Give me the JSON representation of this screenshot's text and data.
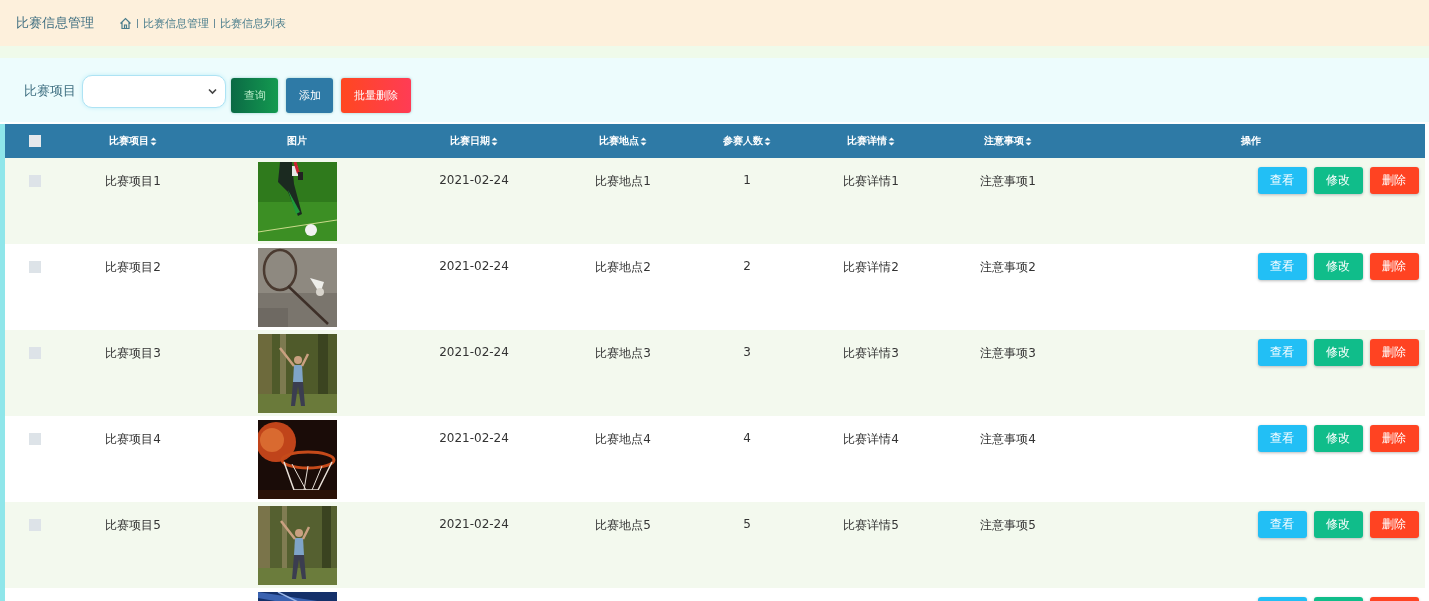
{
  "header": {
    "title": "比赛信息管理",
    "breadcrumb": [
      "比赛信息管理",
      "比赛信息列表"
    ]
  },
  "toolbar": {
    "filter_label": "比赛项目",
    "buttons": [
      {
        "label": "查询",
        "kind": "search"
      },
      {
        "label": "添加",
        "kind": "add"
      },
      {
        "label": "批量删除",
        "kind": "bulkdelete"
      }
    ]
  },
  "table": {
    "select_all": {
      "checked": false
    },
    "columns": [
      {
        "label": "比赛项目",
        "sortable": true
      },
      {
        "label": "图片",
        "sortable": false
      },
      {
        "label": "比赛日期",
        "sortable": true
      },
      {
        "label": "比赛地点",
        "sortable": true
      },
      {
        "label": "参赛人数",
        "sortable": true
      },
      {
        "label": "比赛详情",
        "sortable": true
      },
      {
        "label": "注意事项",
        "sortable": true
      },
      {
        "label": "操作",
        "sortable": false
      }
    ],
    "rows": [
      {
        "kind": "full",
        "checked": false,
        "cells": [
          "比赛项目1",
          "",
          "2021-02-24",
          "比赛地点1",
          "1",
          "比赛详情1",
          "注意事项1"
        ],
        "image": {
          "kind": "picture"
        },
        "actions": [
          {
            "label": "查看",
            "kind": "view"
          },
          {
            "label": "修改",
            "kind": "edit"
          },
          {
            "label": "删除",
            "kind": "delete"
          }
        ]
      },
      {
        "kind": "full",
        "checked": false,
        "cells": [
          "比赛项目2",
          "",
          "2021-02-24",
          "比赛地点2",
          "2",
          "比赛详情2",
          "注意事项2"
        ],
        "image": {
          "kind": "picture"
        },
        "actions": [
          {
            "label": "查看",
            "kind": "view"
          },
          {
            "label": "修改",
            "kind": "edit"
          },
          {
            "label": "删除",
            "kind": "delete"
          }
        ]
      },
      {
        "kind": "full",
        "checked": false,
        "cells": [
          "比赛项目3",
          "",
          "2021-02-24",
          "比赛地点3",
          "3",
          "比赛详情3",
          "注意事项3"
        ],
        "image": {
          "kind": "picture"
        },
        "actions": [
          {
            "label": "查看",
            "kind": "view"
          },
          {
            "label": "修改",
            "kind": "edit"
          },
          {
            "label": "删除",
            "kind": "delete"
          }
        ]
      },
      {
        "kind": "full",
        "checked": false,
        "cells": [
          "比赛项目4",
          "",
          "2021-02-24",
          "比赛地点4",
          "4",
          "比赛详情4",
          "注意事项4"
        ],
        "image": {
          "kind": "picture"
        },
        "actions": [
          {
            "label": "查看",
            "kind": "view"
          },
          {
            "label": "修改",
            "kind": "edit"
          },
          {
            "label": "删除",
            "kind": "delete"
          }
        ]
      },
      {
        "kind": "full",
        "checked": false,
        "cells": [
          "比赛项目5",
          "",
          "2021-02-24",
          "比赛地点5",
          "5",
          "比赛详情5",
          "注意事项5"
        ],
        "image": {
          "kind": "picture"
        },
        "actions": [
          {
            "label": "查看",
            "kind": "view"
          },
          {
            "label": "修改",
            "kind": "edit"
          },
          {
            "label": "删除",
            "kind": "delete"
          }
        ]
      },
      {
        "kind": "partial",
        "image": {
          "kind": "picture"
        },
        "actions": [
          {
            "kind": "view"
          },
          {
            "kind": "edit"
          },
          {
            "kind": "delete"
          }
        ]
      }
    ]
  }
}
